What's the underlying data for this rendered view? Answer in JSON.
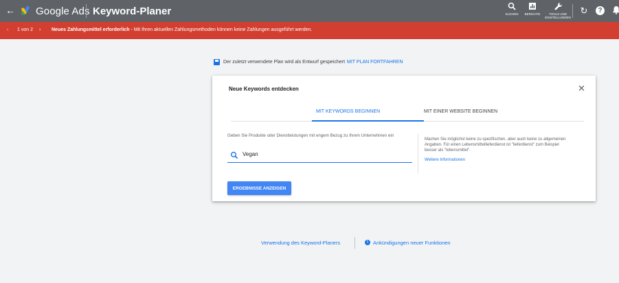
{
  "topbar": {
    "back_icon": "arrow-left-icon",
    "brand": "Google Ads",
    "page_title": "Keyword-Planer",
    "tools": [
      {
        "icon": "search-icon",
        "label": "SUCHEN"
      },
      {
        "icon": "reports-icon",
        "label": "BERICHTE"
      },
      {
        "icon": "wrench-icon",
        "label": "TOOLS UND EINSTELLUNGEN"
      }
    ],
    "refresh_icon": "refresh-icon",
    "help_icon": "help-icon",
    "notifications_icon": "bell-icon"
  },
  "alert": {
    "counter": "1 von 2",
    "message_bold": "Neues Zahlungsmittel erforderlich",
    "message_rest": " - Mit Ihren aktuellen Zahlungsmethoden können keine Zahlungen ausgeführt werden.",
    "color": "#d23f31"
  },
  "draft_notice": {
    "text": "Der zuletzt verwendete Plan wird als Entwurf gespeichert",
    "link": "MIT PLAN FORTFAHREN"
  },
  "card": {
    "title": "Neue Keywords entdecken",
    "tabs": [
      {
        "label": "MIT KEYWORDS BEGINNEN",
        "active": true
      },
      {
        "label": "MIT EINER WEBSITE BEGINNEN",
        "active": false
      }
    ],
    "instruction": "Geben Sie Produkte oder Dienstleistungen mit engem Bezug zu Ihrem Unternehmen ein",
    "search_value": "Vegan",
    "hint": "Machen Sie möglichst keine zu spezifischen, aber auch keine zu allgemeinen Angaben. Für einen Lebensmittellieferdienst ist \"lieferdienst\" zum Beispiel besser als \"lebensmittel\".",
    "more_info": "Weitere Informationen",
    "submit": "ERGEBNISSE ANZEIGEN"
  },
  "footer": {
    "usage_link": "Verwendung des Keyword-Planers",
    "announcements_link": "Ankündigungen neuer Funktionen"
  },
  "colors": {
    "topbar": "#5f6368",
    "accent": "#1a73e8",
    "button": "#4285f4"
  }
}
